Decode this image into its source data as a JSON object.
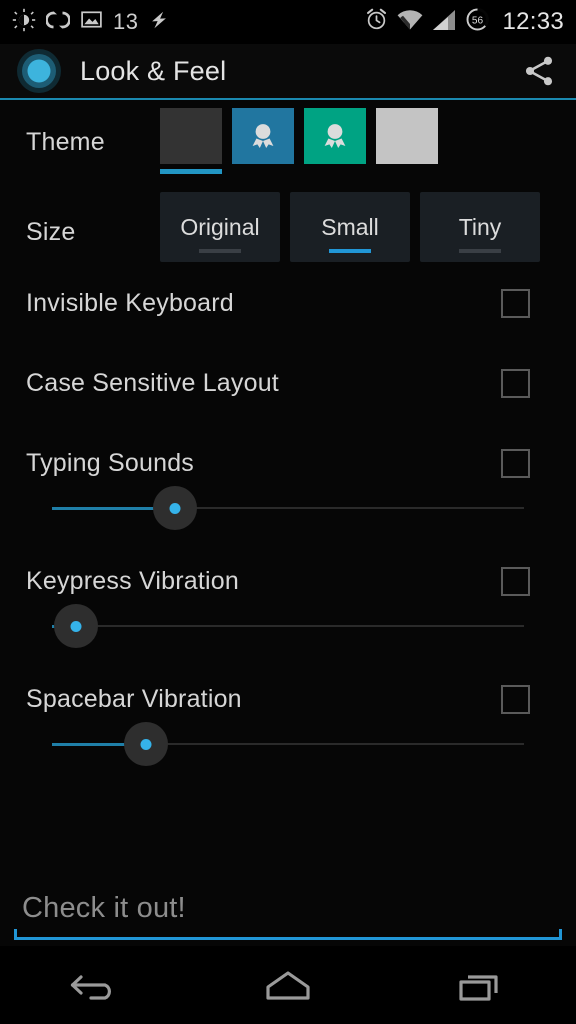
{
  "statusbar": {
    "left_icons": [
      {
        "name": "brightness-auto-icon"
      },
      {
        "name": "sync-icon"
      },
      {
        "name": "image-icon"
      }
    ],
    "notification_count": "13",
    "charging_icon": "lightning-bolt-icon",
    "right_icons": [
      {
        "name": "alarm-clock-icon"
      },
      {
        "name": "wifi-icon"
      },
      {
        "name": "cellular-signal-icon"
      }
    ],
    "battery_level": "56",
    "clock": "12:33"
  },
  "actionbar": {
    "app_icon": "app-logo-icon",
    "title": "Look & Feel",
    "share_icon": "share-icon",
    "accent_color": "#2196d6"
  },
  "theme": {
    "label": "Theme",
    "selected_index": 0,
    "options": [
      {
        "name": "theme-dark",
        "color": "#333333",
        "has_badge": false,
        "selected": true
      },
      {
        "name": "theme-blue",
        "color": "#2176a0",
        "has_badge": true,
        "selected": false
      },
      {
        "name": "theme-green",
        "color": "#00a383",
        "has_badge": true,
        "selected": false
      },
      {
        "name": "theme-light",
        "color": "#c4c4c4",
        "has_badge": false,
        "selected": false
      }
    ]
  },
  "size": {
    "label": "Size",
    "selected": "Small",
    "options": [
      {
        "label": "Original",
        "selected": false
      },
      {
        "label": "Small",
        "selected": true
      },
      {
        "label": "Tiny",
        "selected": false
      }
    ]
  },
  "settings": [
    {
      "name": "invisible-keyboard",
      "title": "Invisible Keyboard",
      "checked": false,
      "slider": null
    },
    {
      "name": "case-sensitive-layout",
      "title": "Case Sensitive Layout",
      "checked": false,
      "slider": null
    },
    {
      "name": "typing-sounds",
      "title": "Typing Sounds",
      "checked": false,
      "slider": 26
    },
    {
      "name": "keypress-vibration",
      "title": "Keypress Vibration",
      "checked": false,
      "slider": 5
    },
    {
      "name": "spacebar-vibration",
      "title": "Spacebar Vibration",
      "checked": false,
      "slider": 20
    }
  ],
  "input": {
    "value": "",
    "placeholder": "Check it out!"
  },
  "navbar": {
    "back": "back-icon",
    "home": "home-icon",
    "recents": "recents-icon"
  }
}
